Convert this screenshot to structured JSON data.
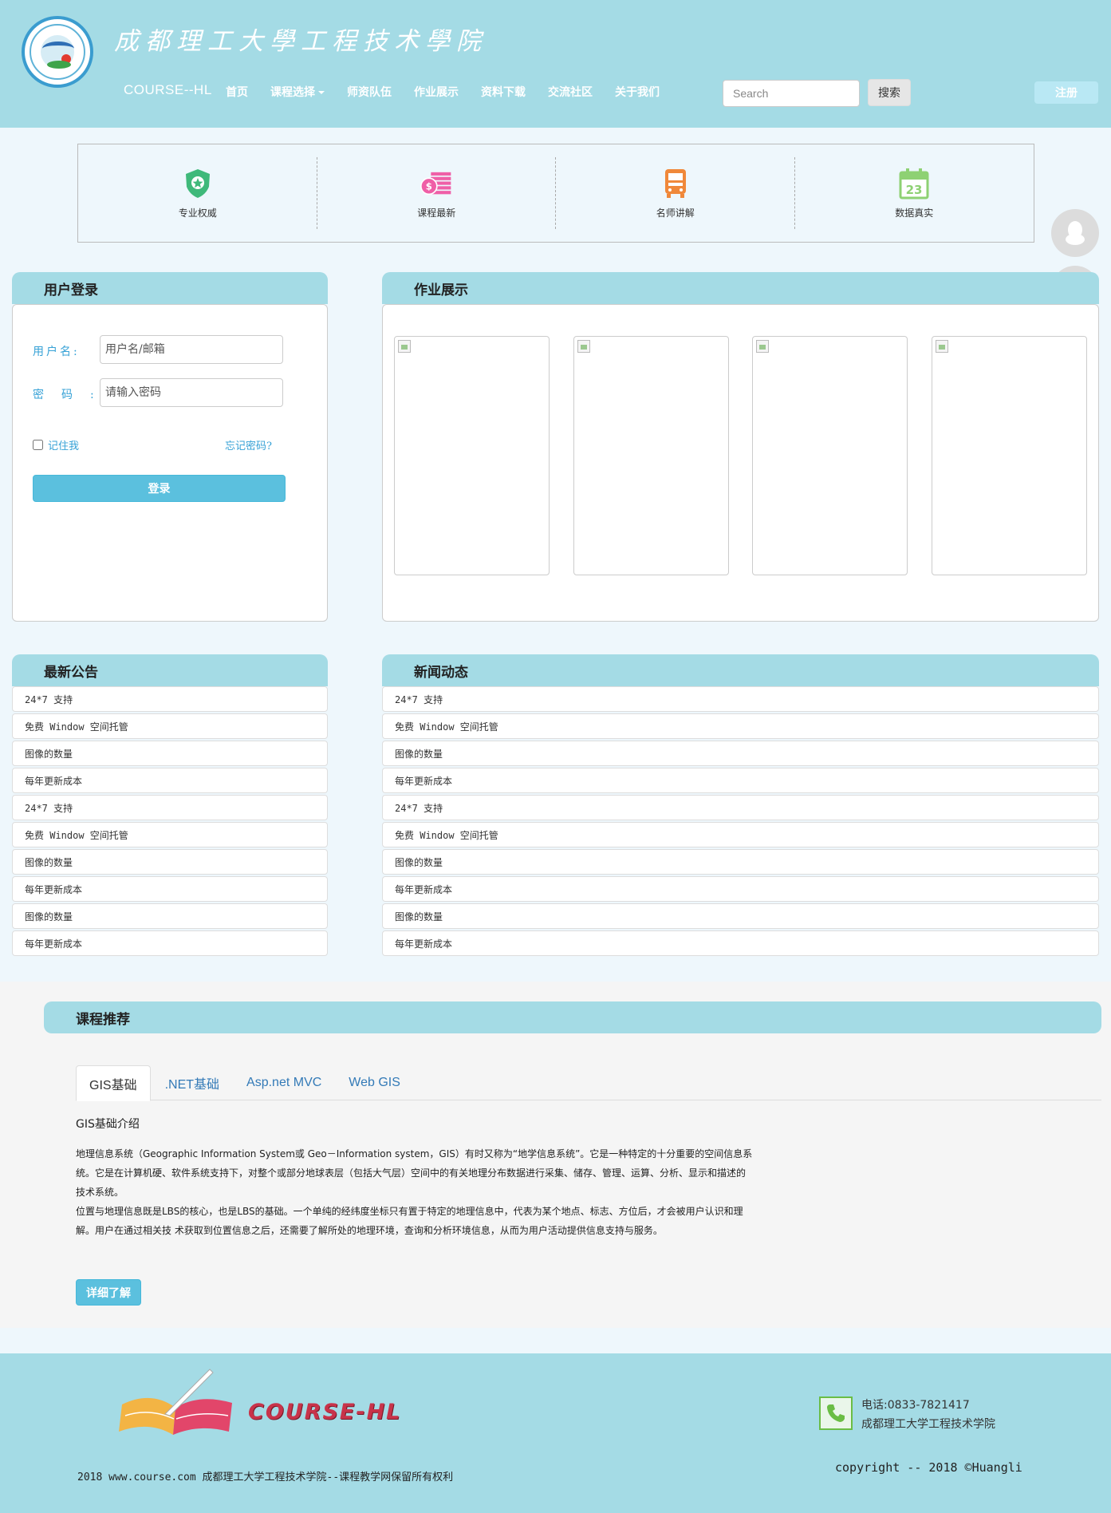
{
  "header": {
    "site_title": "成都理工大學工程技术學院",
    "brand": "COURSE--HL",
    "nav": [
      "首页",
      "课程选择",
      "师资队伍",
      "作业展示",
      "资料下载",
      "交流社区",
      "关于我们"
    ],
    "search_placeholder": "Search",
    "search_button": "搜索",
    "register_button": "注册"
  },
  "features": [
    {
      "label": "专业权威",
      "icon": "shield-star-icon",
      "color": "#3fb97a"
    },
    {
      "label": "课程最新",
      "icon": "coin-stack-icon",
      "color": "#ef5fa7"
    },
    {
      "label": "名师讲解",
      "icon": "bus-icon",
      "color": "#f0883a"
    },
    {
      "label": "数据真实",
      "icon": "calendar-icon",
      "color": "#8ed173",
      "calendar_day": "23"
    }
  ],
  "login": {
    "title": "用户登录",
    "username_label": "用户名:",
    "username_placeholder": "用户名/邮箱",
    "password_label": "密码:",
    "password_placeholder": "请输入密码",
    "remember": "记住我",
    "forgot": "忘记密码?",
    "submit": "登录"
  },
  "homework": {
    "title": "作业展示"
  },
  "notices": {
    "title": "最新公告",
    "items": [
      "24*7 支持",
      "免费 Window 空间托管",
      "图像的数量",
      "每年更新成本",
      "24*7 支持",
      "免费 Window 空间托管",
      "图像的数量",
      "每年更新成本",
      "图像的数量",
      "每年更新成本"
    ]
  },
  "news": {
    "title": "新闻动态",
    "items": [
      "24*7 支持",
      "免费 Window 空间托管",
      "图像的数量",
      "每年更新成本",
      "24*7 支持",
      "免费 Window 空间托管",
      "图像的数量",
      "每年更新成本",
      "图像的数量",
      "每年更新成本"
    ]
  },
  "courses": {
    "title": "课程推荐",
    "tabs": [
      "GIS基础",
      ".NET基础",
      "Asp.net MVC",
      "Web GIS"
    ],
    "active_tab": "GIS基础",
    "content_title": "GIS基础介绍",
    "paragraph1": "地理信息系统（Geographic Information System或 Geo－Information system，GIS）有时又称为“地学信息系统”。它是一种特定的十分重要的空间信息系统。它是在计算机硬、软件系统支持下，对整个或部分地球表层（包括大气层）空间中的有关地理分布数据进行采集、储存、管理、运算、分析、显示和描述的技术系统。",
    "paragraph2": "位置与地理信息既是LBS的核心，也是LBS的基础。一个单纯的经纬度坐标只有置于特定的地理信息中，代表为某个地点、标志、方位后，才会被用户认识和理解。用户在通过相关技 术获取到位置信息之后，还需要了解所处的地理环境，查询和分析环境信息，从而为用户活动提供信息支持与服务。",
    "more_button": "详细了解"
  },
  "footer": {
    "brand": "COURSE-HL",
    "phone": "电话:0833-7821417",
    "school": "成都理工大学工程技术学院",
    "copyright": "copyright -- 2018 ©Huangli",
    "rights": "2018 www.course.com 成都理工大学工程技术学院--课程教学网保留所有权利"
  },
  "colors": {
    "header_bg": "#a4dbe5",
    "accent": "#5bc0de",
    "link": "#337ab7"
  }
}
